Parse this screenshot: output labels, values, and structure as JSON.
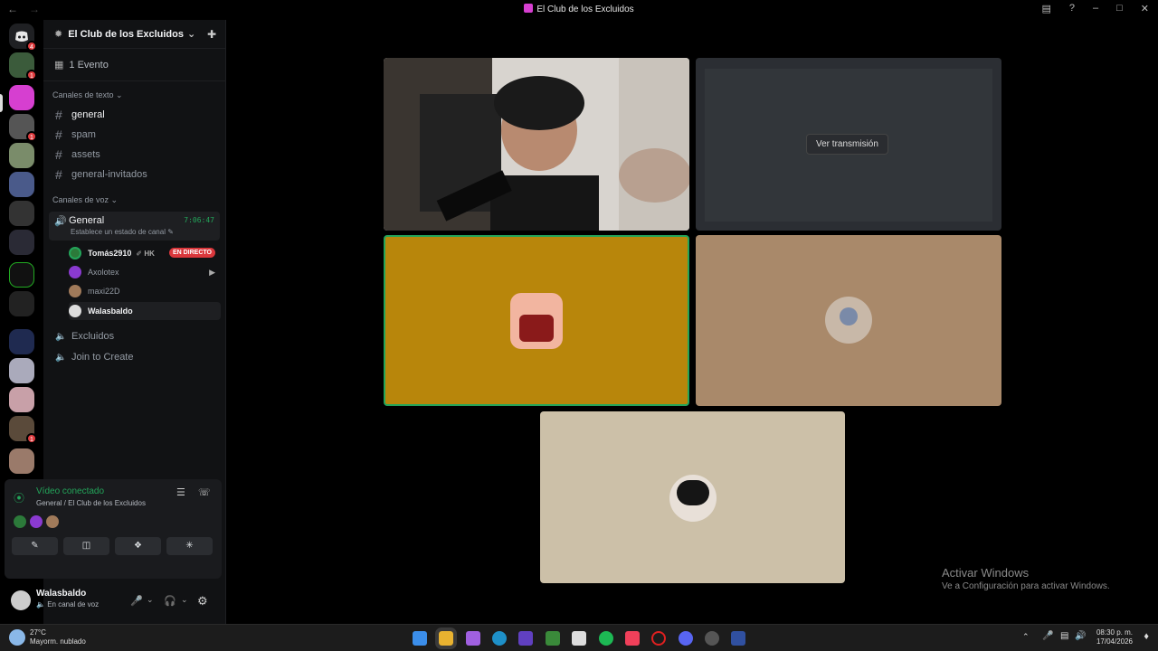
{
  "window": {
    "title": "El Club de los Excluidos"
  },
  "server": {
    "name": "El Club de los Excluidos",
    "events": "1 Evento"
  },
  "categories": {
    "text": "Canales de texto",
    "voice": "Canales de voz"
  },
  "text_channels": [
    "general",
    "spam",
    "assets",
    "general-invitados"
  ],
  "voice": {
    "active_channel": "General",
    "timer": "7:06:47",
    "status_hint": "Establece un estado de canal",
    "users": [
      {
        "name": "Tomás2910",
        "tag": "HK",
        "live": "EN DIRECTO"
      },
      {
        "name": "Axolotex"
      },
      {
        "name": "maxi22D"
      },
      {
        "name": "Walasbaldo"
      }
    ],
    "other_channels": [
      "Excluidos",
      "Join to Create"
    ]
  },
  "stream_overlay": {
    "label": "Ver transmisión"
  },
  "connection": {
    "status": "Vídeo conectado",
    "location": "General / El Club de los Excluidos"
  },
  "current_user": {
    "name": "Walasbaldo",
    "status": "En canal de voz"
  },
  "watermark": {
    "line1": "Activar Windows",
    "line2": "Ve a Configuración para activar Windows."
  },
  "taskbar": {
    "weather_temp": "27°C",
    "weather_desc": "Mayorm. nublado",
    "time": "08:30 p. m.",
    "date": "17/04/2026"
  },
  "colors": {
    "accent_green": "#23a55a",
    "live_red": "#da373c",
    "tile_orange": "#b8860b",
    "tile_tan": "#a9896a",
    "tile_beige": "#ccc0a8"
  }
}
